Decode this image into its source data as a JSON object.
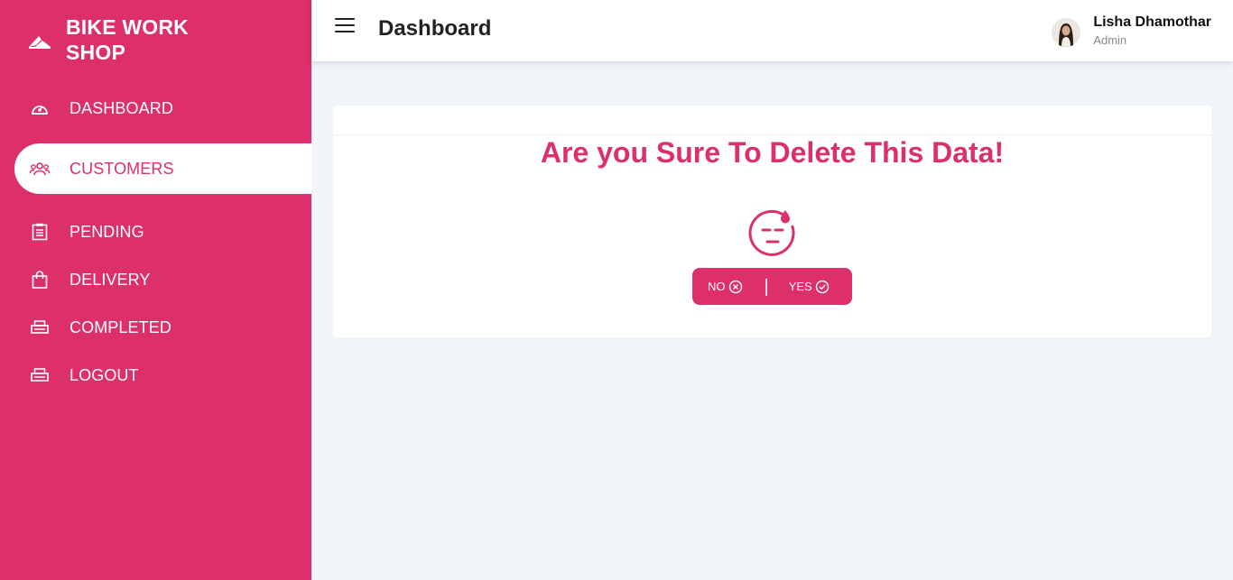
{
  "brand": {
    "name": "BIKE WORK SHOP"
  },
  "sidebar": {
    "items": [
      {
        "label": "DASHBOARD",
        "icon": "dashboard-icon"
      },
      {
        "label": "CUSTOMERS",
        "icon": "users-icon",
        "active": true
      },
      {
        "label": "PENDING",
        "icon": "clipboard-icon"
      },
      {
        "label": "DELIVERY",
        "icon": "bag-icon"
      },
      {
        "label": "COMPLETED",
        "icon": "printer-icon"
      },
      {
        "label": "LOGOUT",
        "icon": "printer-icon"
      }
    ]
  },
  "header": {
    "title": "Dashboard"
  },
  "user": {
    "name": "Lisha Dhamothar",
    "role": "Admin"
  },
  "dialog": {
    "title": "Are you Sure To Delete This Data!",
    "no_label": "NO",
    "yes_label": "YES",
    "separator": "|"
  },
  "colors": {
    "accent": "#dc2f6c",
    "background": "#f1f4f9"
  }
}
